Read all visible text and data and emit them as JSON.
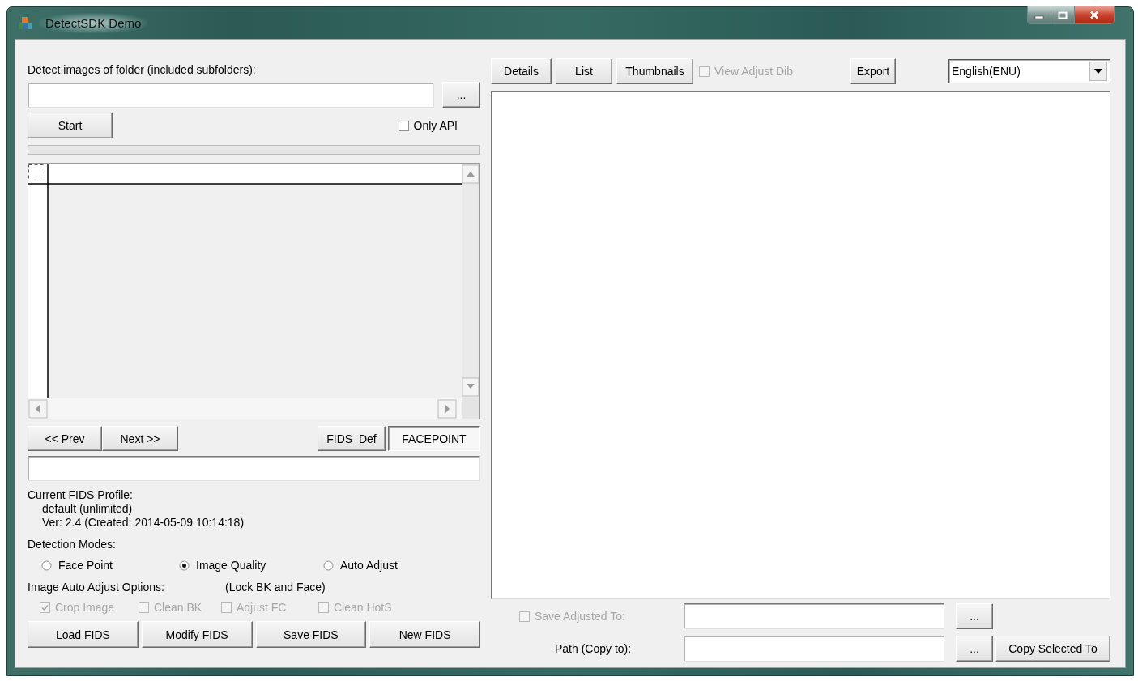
{
  "window": {
    "title": "DetectSDK Demo"
  },
  "folder": {
    "label": "Detect images of folder (included subfolders):",
    "browse_button": "..."
  },
  "start_button": "Start",
  "only_api": {
    "label": "Only API",
    "checked": false
  },
  "progress": {
    "level": 0
  },
  "nav_buttons": [
    "<< Prev",
    "Next >>"
  ],
  "profile_tabs": [
    {
      "label": "FIDS_Def",
      "selected": false
    },
    {
      "label": "FACEPOINT",
      "selected": true
    }
  ],
  "profile": {
    "heading": "Current FIDS Profile:",
    "name": "default (unlimited)",
    "version": "Ver: 2.4 (Created: 2014-05-09 10:14:18)"
  },
  "detection_modes": {
    "label": "Detection Modes:",
    "options": [
      {
        "label": "Face Point",
        "selected": false
      },
      {
        "label": "Image Quality",
        "selected": true
      },
      {
        "label": "Auto Adjust",
        "selected": false
      }
    ]
  },
  "adjust_options": {
    "label": "Image Auto Adjust Options:",
    "note": "(Lock BK and Face)",
    "options": [
      {
        "label": "Crop Image",
        "checked": true,
        "disabled": true
      },
      {
        "label": "Clean BK",
        "checked": false,
        "disabled": true
      },
      {
        "label": "Adjust FC",
        "checked": false,
        "disabled": true
      },
      {
        "label": "Clean HotS",
        "checked": false,
        "disabled": true
      }
    ]
  },
  "fids_buttons": [
    "Load FIDS",
    "Modify FIDS",
    "Save FIDS",
    "New FIDS"
  ],
  "view_buttons": [
    "Details",
    "List",
    "Thumbnails"
  ],
  "view_adjust_dib": {
    "label": "View Adjust Dib",
    "checked": false,
    "disabled": true
  },
  "export_button": "Export",
  "language": {
    "value": "English(ENU)"
  },
  "save_adjusted": {
    "label": "Save Adjusted To:",
    "checked": false,
    "disabled": true,
    "browse_button": "..."
  },
  "copy_path": {
    "label": "Path (Copy to):",
    "browse_button": "...",
    "copy_button": "Copy Selected To"
  }
}
